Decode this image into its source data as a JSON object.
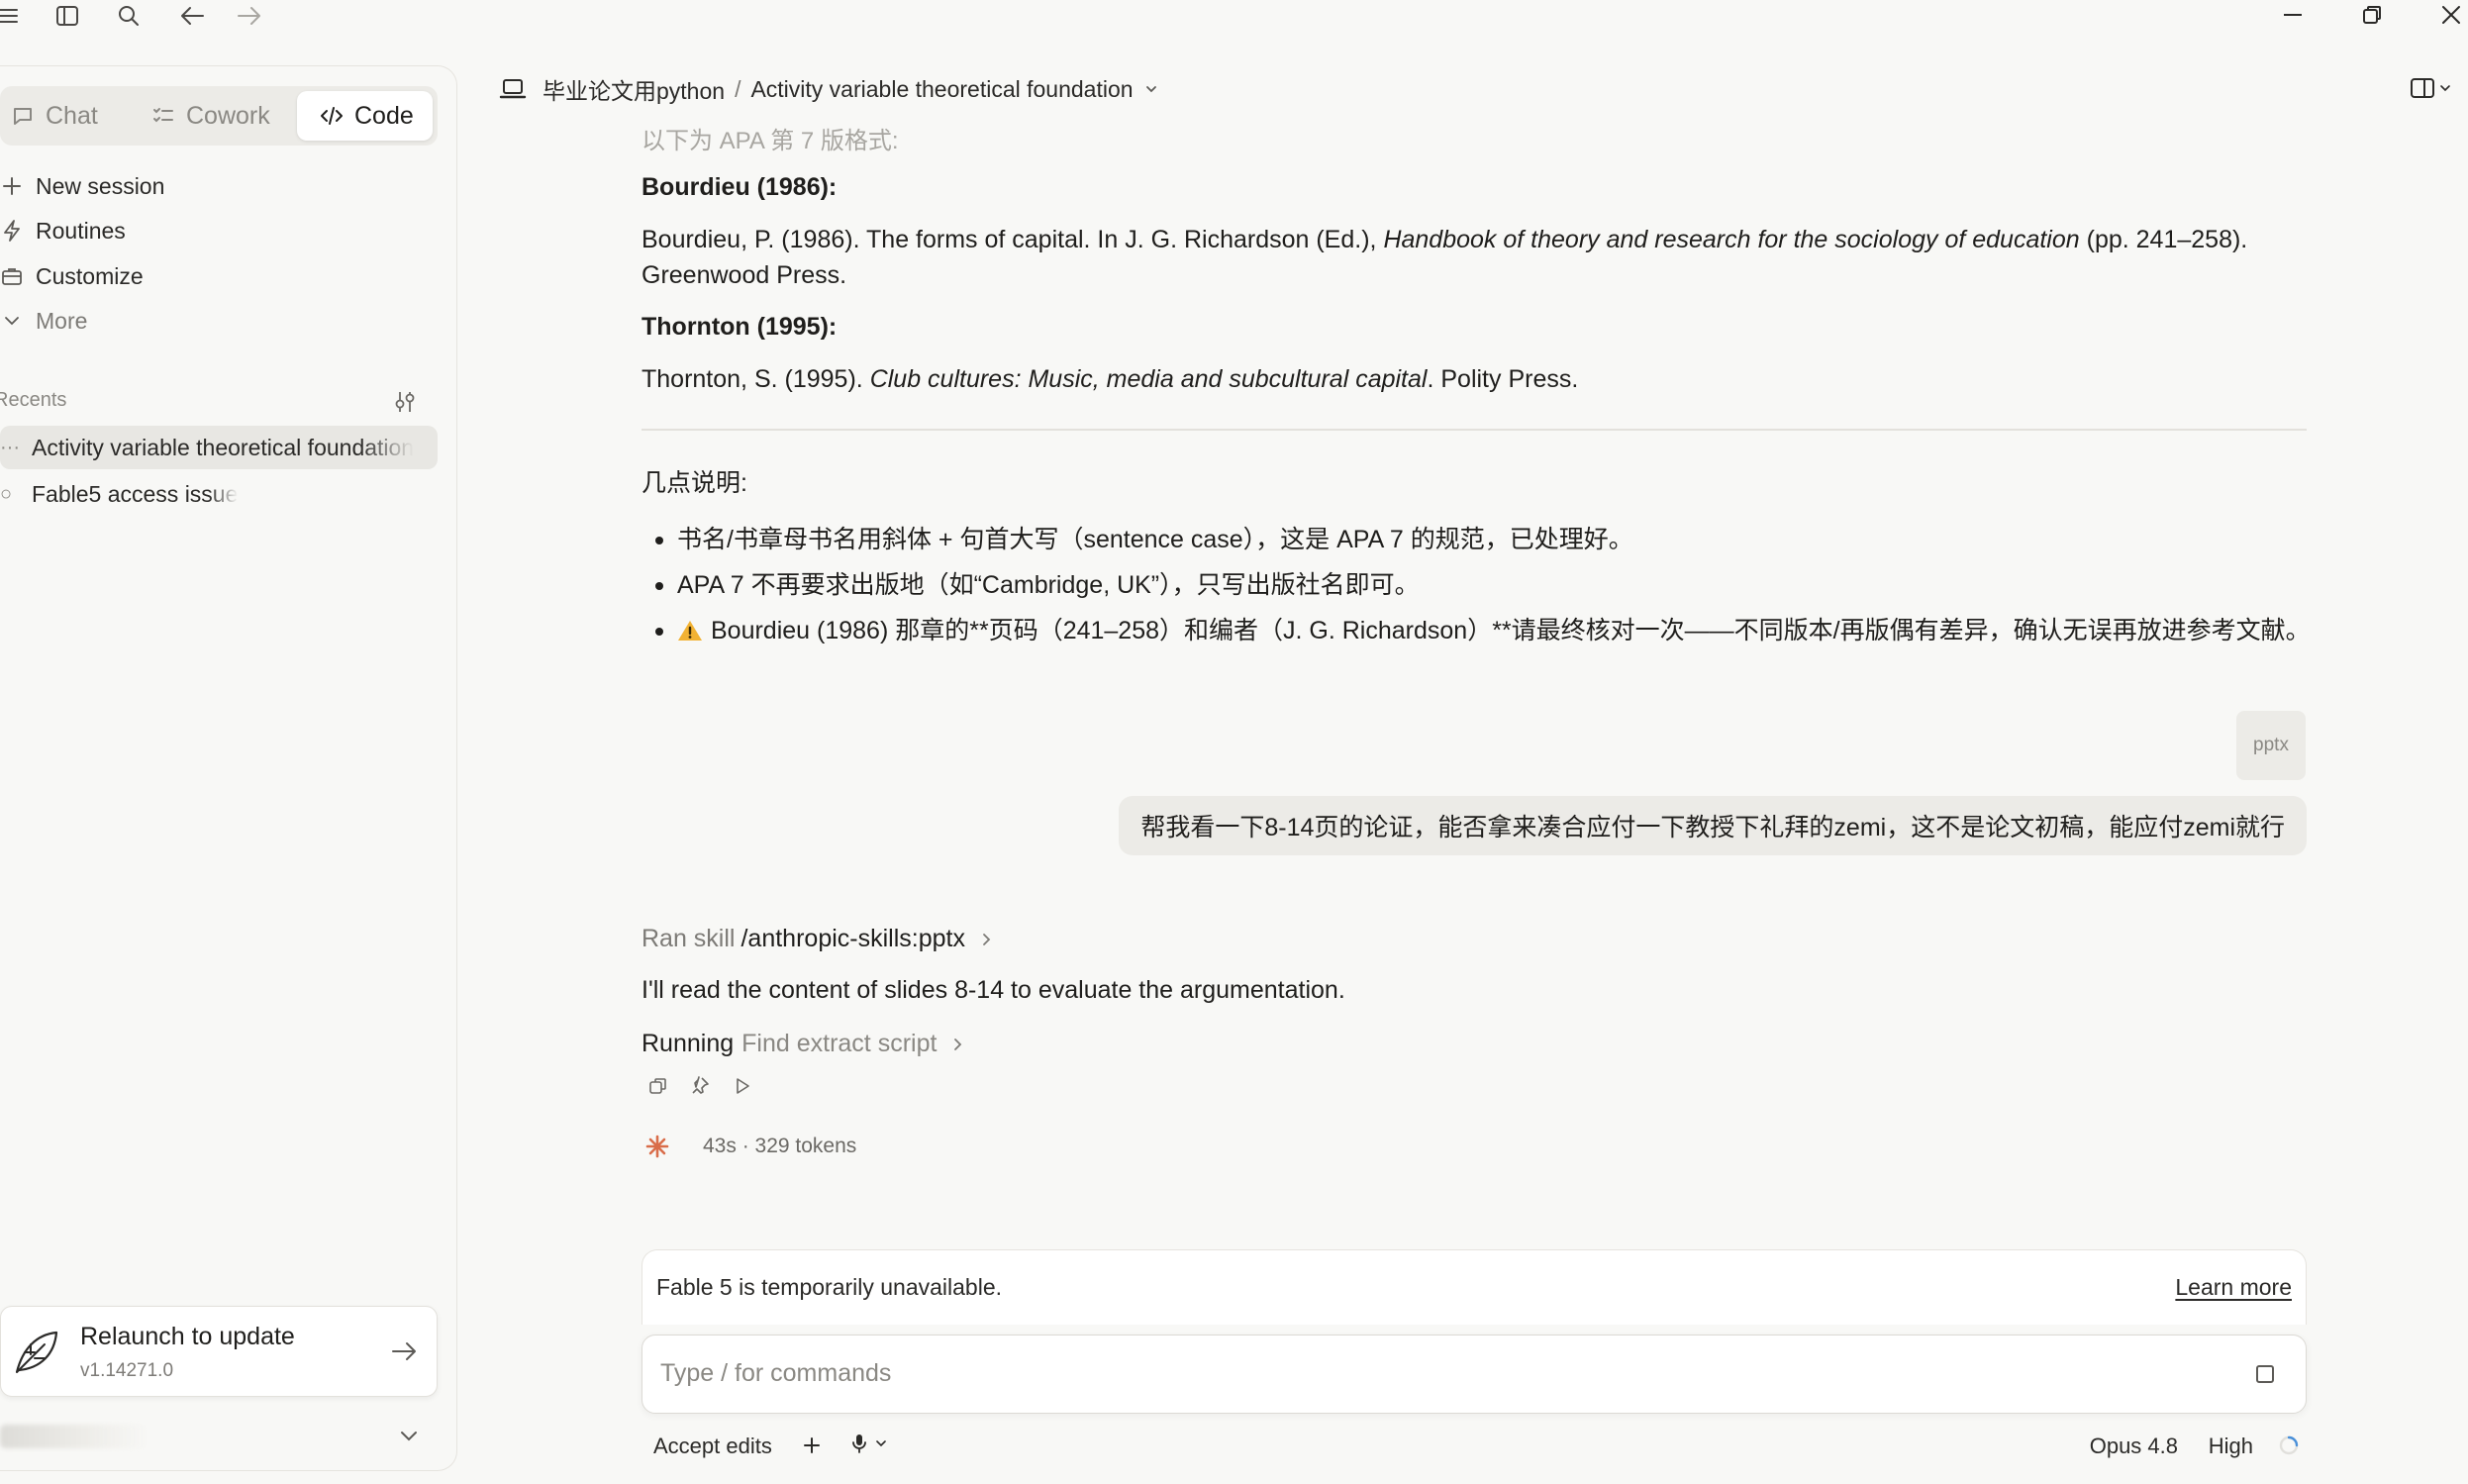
{
  "titlebar": {
    "icons": [
      "menu-icon",
      "sidebar-toggle-icon",
      "search-icon",
      "back-arrow-icon",
      "forward-arrow-icon"
    ],
    "window_controls": [
      "minimize-icon",
      "restore-icon",
      "close-icon"
    ]
  },
  "sidebar": {
    "modes": [
      {
        "label": "Chat",
        "icon": "chat-bubble-icon"
      },
      {
        "label": "Cowork",
        "icon": "checklist-icon"
      },
      {
        "label": "Code",
        "icon": "code-icon",
        "active": true
      }
    ],
    "nav": [
      {
        "label": "New session",
        "icon": "plus-icon"
      },
      {
        "label": "Routines",
        "icon": "bolt-icon"
      },
      {
        "label": "Customize",
        "icon": "briefcase-icon"
      },
      {
        "label": "More",
        "icon": "chevron-down-icon"
      }
    ],
    "recents_label": "Recents",
    "recents": [
      {
        "lead": "···",
        "title": "Activity variable theoretical foundation",
        "active": true
      },
      {
        "lead": "○",
        "title": "Fable5 access issue",
        "active": false
      }
    ],
    "update": {
      "title": "Relaunch to update",
      "version": "v1.14271.0"
    }
  },
  "header": {
    "project": "毕业论文用python",
    "separator": "/",
    "session": "Activity variable theoretical foundation"
  },
  "conversation": {
    "faded_line": "以下为 APA 第 7 版格式:",
    "ref1_heading": "Bourdieu (1986):",
    "ref1_pre": "Bourdieu, P. (1986). The forms of capital. In J. G. Richardson (Ed.),",
    "ref1_italic": "Handbook of theory and research for the sociology of education",
    "ref1_post": "(pp. 241–258). Greenwood Press.",
    "ref2_heading": "Thornton (1995):",
    "ref2_pre": "Thornton, S. (1995).",
    "ref2_italic": "Club cultures: Music, media and subcultural capital",
    "ref2_post": ". Polity Press.",
    "notes_heading": "几点说明:",
    "notes": [
      "书名/书章母书名用斜体 + 句首大写（sentence case），这是 APA 7 的规范，已处理好。",
      "APA 7 不再要求出版地（如“Cambridge, UK”），只写出版社名即可。",
      "Bourdieu (1986) 那章的**页码（241–258）和编者（J. G. Richardson）**请最终核对一次——不同版本/再版偶有差异，确认无误再放进参考文献。"
    ],
    "attachment_label": "pptx",
    "user_message": "帮我看一下8-14页的论证，能否拿来凑合应付一下教授下礼拜的zemi，这不是论文初稿，能应付zemi就行",
    "ran_prefix": "Ran skill",
    "ran_skill": "/anthropic-skills:pptx",
    "reply": "I'll read the content of slides 8-14 to evaluate the argumentation.",
    "running_label": "Running",
    "running_step": "Find extract script",
    "stats": "43s · 329 tokens",
    "accent_color": "#d96d4a"
  },
  "composer": {
    "notice": "Fable 5 is temporarily unavailable.",
    "learn_more": "Learn more",
    "placeholder": "Type / for commands",
    "accept_edits": "Accept edits",
    "model": "Opus 4.8",
    "effort": "High"
  }
}
